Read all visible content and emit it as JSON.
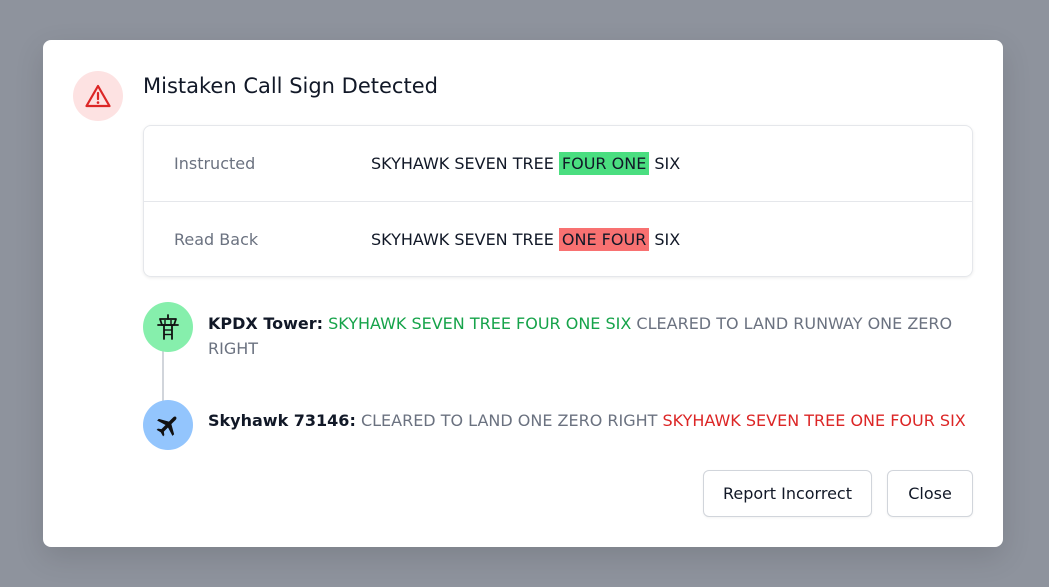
{
  "dialog": {
    "title": "Mistaken Call Sign Detected",
    "icon": "warning-triangle-icon"
  },
  "comparison": {
    "instructed": {
      "label": "Instructed",
      "prefix": "SKYHAWK SEVEN TREE ",
      "highlight": "FOUR ONE",
      "suffix": " SIX",
      "highlight_color": "#4ade80"
    },
    "read_back": {
      "label": "Read Back",
      "prefix": "SKYHAWK SEVEN TREE ",
      "highlight": "ONE FOUR",
      "suffix": " SIX",
      "highlight_color": "#f87171"
    }
  },
  "transcript": [
    {
      "speaker": "KPDX Tower:",
      "icon": "control-tower-icon",
      "callsign": "SKYHAWK SEVEN TREE FOUR ONE SIX",
      "text": " CLEARED TO LAND RUNWAY ONE ZERO RIGHT",
      "callsign_color": "#16a34a"
    },
    {
      "speaker": "Skyhawk 73146:",
      "icon": "airplane-icon",
      "text": "CLEARED TO LAND ONE ZERO RIGHT ",
      "callsign": "SKYHAWK SEVEN TREE ONE FOUR SIX",
      "callsign_color": "#dc2626"
    }
  ],
  "actions": {
    "report_label": "Report Incorrect",
    "close_label": "Close"
  }
}
